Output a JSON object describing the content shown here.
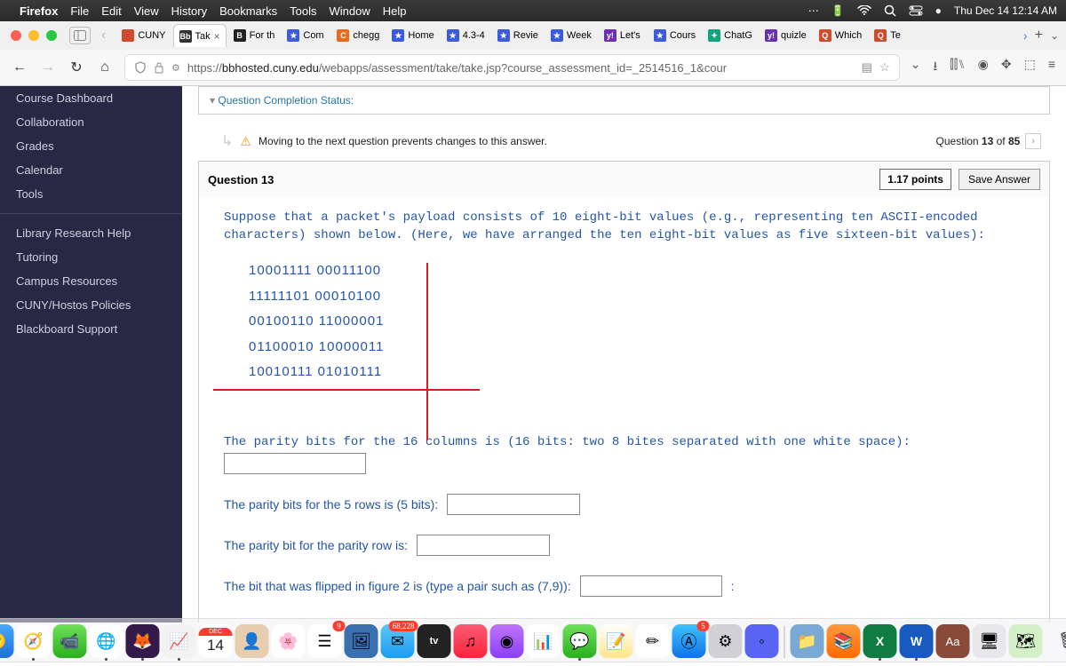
{
  "menubar": {
    "app": "Firefox",
    "items": [
      "File",
      "Edit",
      "View",
      "History",
      "Bookmarks",
      "Tools",
      "Window",
      "Help"
    ],
    "datetime": "Thu Dec 14  12:14 AM"
  },
  "tabs": [
    {
      "label": "CUNY",
      "favColor": "#d14b2a"
    },
    {
      "label": "Tak",
      "favColor": "#333",
      "favText": "Bb",
      "active": true,
      "closable": true
    },
    {
      "label": "For th",
      "favColor": "#222",
      "favText": "B"
    },
    {
      "label": "Com",
      "favColor": "#3b5bdb",
      "favText": "★"
    },
    {
      "label": "chegg",
      "favColor": "#eb6b1a",
      "favText": "C"
    },
    {
      "label": "Home",
      "favColor": "#3b5bdb",
      "favText": "★"
    },
    {
      "label": "4.3-4",
      "favColor": "#3b5bdb",
      "favText": "★"
    },
    {
      "label": "Revie",
      "favColor": "#3b5bdb",
      "favText": "★"
    },
    {
      "label": "Week",
      "favColor": "#3b5bdb",
      "favText": "★"
    },
    {
      "label": "Let's",
      "favColor": "#6b2fb3",
      "favText": "y!"
    },
    {
      "label": "Cours",
      "favColor": "#3b5bdb",
      "favText": "★"
    },
    {
      "label": "ChatG",
      "favColor": "#10a37f",
      "favText": "✦"
    },
    {
      "label": "quizle",
      "favColor": "#6b2fb3",
      "favText": "y!"
    },
    {
      "label": "Which",
      "favColor": "#d14b2a",
      "favText": "Q"
    },
    {
      "label": "Te",
      "favColor": "#d14b2a",
      "favText": "Q"
    }
  ],
  "url": {
    "prefix": "https://",
    "domain": "bbhosted.cuny.edu",
    "path": "/webapps/assessment/take/take.jsp?course_assessment_id=_2514516_1&cour"
  },
  "sidebar": {
    "groups": [
      [
        "Course Dashboard",
        "Collaboration",
        "Grades",
        "Calendar",
        "Tools"
      ],
      [
        "Library Research Help",
        "Tutoring",
        "Campus Resources",
        "CUNY/Hostos Policies",
        "Blackboard Support"
      ]
    ]
  },
  "question": {
    "completionLabel": "Question Completion Status:",
    "warning": "Moving to the next question prevents changes to this answer.",
    "navLabel_pre": "Question ",
    "navLabel_num": "13",
    "navLabel_mid": " of ",
    "navLabel_total": "85",
    "title": "Question 13",
    "points": "1.17 points",
    "saveLabel": "Save Answer",
    "prompt": "Suppose that a packet's payload consists of 10 eight-bit values (e.g., representing ten ASCII-encoded characters) shown below. (Here, we have arranged the ten eight-bit values as five sixteen-bit values):",
    "bits": [
      "10001111 00011100",
      "11111101 00010100",
      "00100110 11000001",
      "01100010 10000011",
      "10010111 01010111"
    ],
    "parity16": "The parity bits for the 16 columns is (16 bits: two 8 bites separated with one white space):",
    "parity5": "The parity bits for the 5 rows is (5 bits):",
    "parityRow": "The parity bit for the parity row is:",
    "flipped": "The bit that was flipped in figure 2 is (type a pair such as (7,9)):",
    "flippedSuffix": ":"
  },
  "calendar": {
    "month": "DEC",
    "day": "14"
  },
  "badges": {
    "mail": "68,228",
    "reminders": "9",
    "appstore": "5"
  }
}
